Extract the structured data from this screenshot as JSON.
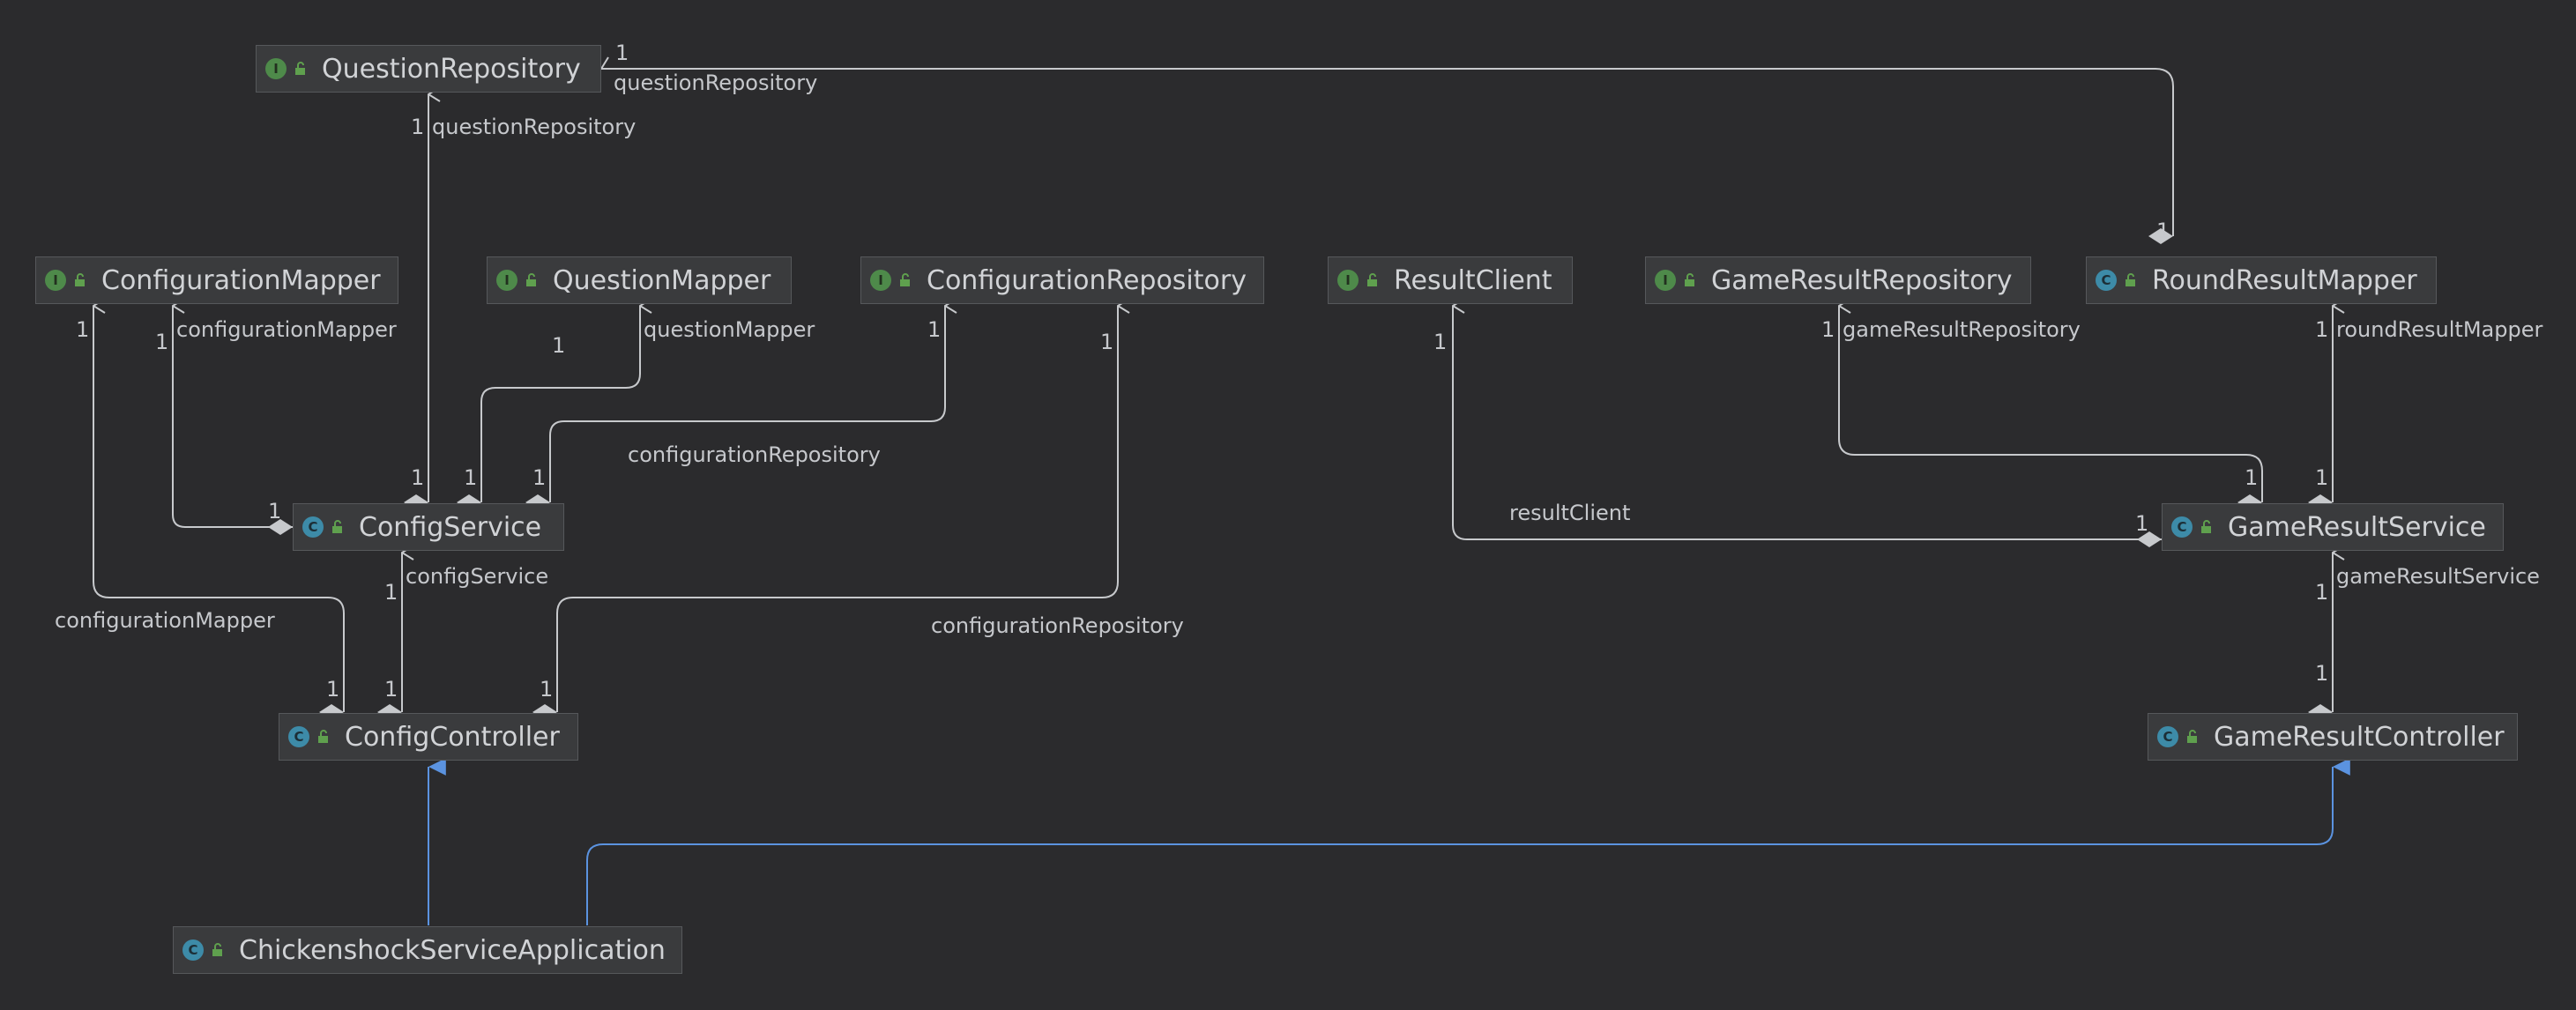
{
  "colors": {
    "background": "#2b2b2d",
    "node_fill": "#3a3b3d",
    "association": "#c7c9cc",
    "inheritance": "#5b93e0",
    "interface_icon": "#4e8a4a",
    "class_icon": "#3d8ba8"
  },
  "nodes": {
    "question_repository": {
      "name": "QuestionRepository",
      "kind": "interface"
    },
    "configuration_mapper": {
      "name": "ConfigurationMapper",
      "kind": "interface"
    },
    "question_mapper": {
      "name": "QuestionMapper",
      "kind": "interface"
    },
    "configuration_repository": {
      "name": "ConfigurationRepository",
      "kind": "interface"
    },
    "result_client": {
      "name": "ResultClient",
      "kind": "interface"
    },
    "game_result_repository": {
      "name": "GameResultRepository",
      "kind": "interface"
    },
    "round_result_mapper": {
      "name": "RoundResultMapper",
      "kind": "class"
    },
    "config_service": {
      "name": "ConfigService",
      "kind": "class"
    },
    "game_result_service": {
      "name": "GameResultService",
      "kind": "class"
    },
    "config_controller": {
      "name": "ConfigController",
      "kind": "class"
    },
    "game_result_controller": {
      "name": "GameResultController",
      "kind": "class"
    },
    "application": {
      "name": "ChickenshockServiceApplication",
      "kind": "application"
    }
  },
  "edge_labels": {
    "rrm_qr_role": "questionRepository",
    "rrm_qr_mult_top": "1",
    "rrm_qr_mult_bottom": "1",
    "cs_qr_role": "questionRepository",
    "cs_qr_mult_top": "1",
    "cs_qr_mult_bottom": "1",
    "cs_cm_role": "configurationMapper",
    "cs_cm_mult_top": "1",
    "cs_cm_mult_bottom": "1",
    "cs_qm_role": "questionMapper",
    "cs_qm_mult_top": "1",
    "cs_qm_mult_bottom": "1",
    "cs_cr_role": "configurationRepository",
    "cs_cr_mult_top": "1",
    "cs_cr_mult_bottom": "1",
    "cc_cm_role": "configurationMapper",
    "cc_cm_mult_top": "1",
    "cc_cm_mult_bottom": "1",
    "cc_cs_role": "configService",
    "cc_cs_mult_top": "1",
    "cc_cs_mult_bottom": "1",
    "cc_cr_role": "configurationRepository",
    "cc_cr_mult_top": "1",
    "cc_cr_mult_bottom": "1",
    "grs_rc_role": "resultClient",
    "grs_rc_mult_top": "1",
    "grs_rc_mult_bottom": "1",
    "grs_grr_role": "gameResultRepository",
    "grs_grr_mult_top": "1",
    "grs_grr_mult_bottom": "1",
    "grs_rrm_role": "roundResultMapper",
    "grs_rrm_mult_top": "1",
    "grs_rrm_mult_bottom": "1",
    "grc_grs_role": "gameResultService",
    "grc_grs_mult_top": "1",
    "grc_grs_mult_bottom": "1"
  }
}
